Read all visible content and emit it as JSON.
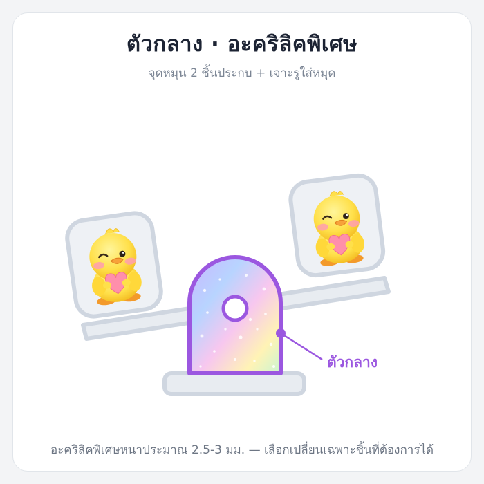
{
  "header": {
    "title": "ตัวกลาง  ·  อะคริลิคพิเศษ",
    "subtitle": "จุดหมุน 2 ชิ้นประกบ + เจาะรูใส่หมุด"
  },
  "diagram": {
    "callout_label": "ตัวกลาง",
    "left_panel_icon": "duckling-heart-icon",
    "right_panel_icon": "duckling-heart-icon",
    "accent_color": "#9b57e0",
    "frame_color": "#cfd6e0"
  },
  "footer": {
    "note": "อะคริลิคพิเศษหนาประมาณ 2.5-3 มม. — เลือกเปลี่ยนเฉพาะชิ้นที่ต้องการได้"
  }
}
